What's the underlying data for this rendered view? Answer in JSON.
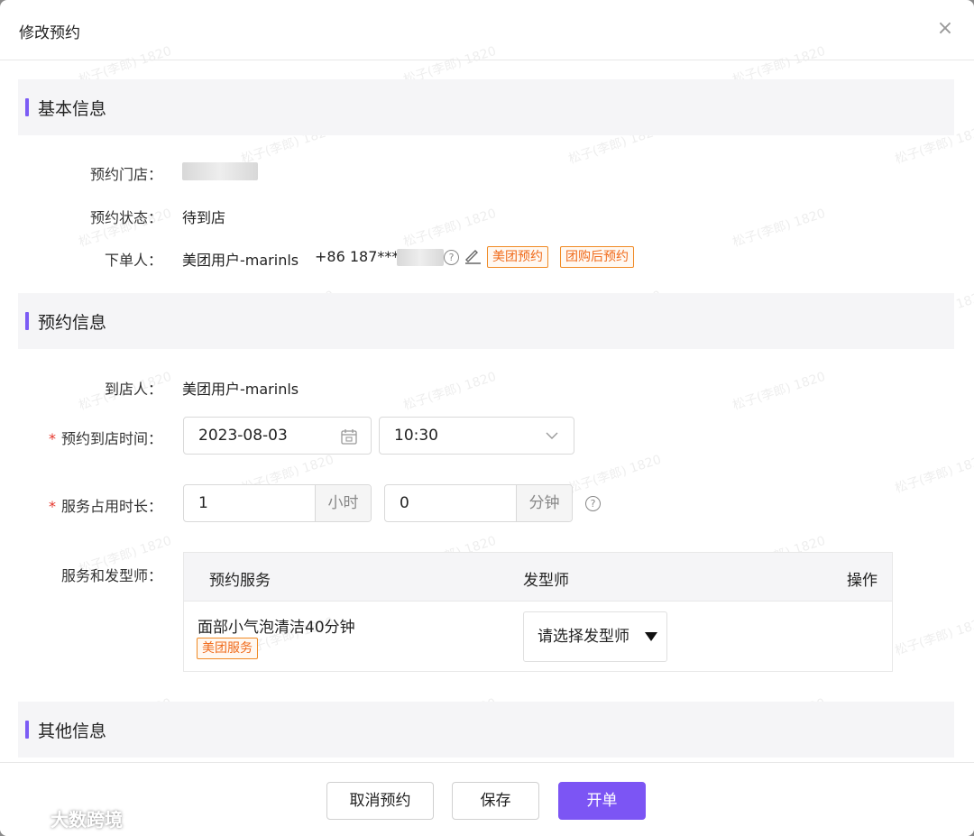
{
  "modal": {
    "title": "修改预约"
  },
  "sections": {
    "basic": "基本信息",
    "booking": "预约信息",
    "other": "其他信息"
  },
  "basic": {
    "store_label": "预约门店：",
    "status_label": "预约状态：",
    "status_value": "待到店",
    "orderer_label": "下单人：",
    "orderer_name": "美团用户-marinls",
    "orderer_phone": "+86 187***",
    "tags": [
      "美团预约",
      "团购后预约"
    ]
  },
  "booking": {
    "visitor_label": "到店人：",
    "visitor_value": "美团用户-marinls",
    "time_label": "预约到店时间：",
    "date_value": "2023-08-03",
    "time_value": "10:30",
    "duration_label": "服务占用时长：",
    "hours_value": "1",
    "hours_unit": "小时",
    "minutes_value": "0",
    "minutes_unit": "分钟",
    "services_label": "服务和发型师：",
    "table": {
      "headers": [
        "预约服务",
        "发型师",
        "操作"
      ],
      "row": {
        "service": "面部小气泡清洁40分钟",
        "tag": "美团服务",
        "stylist_placeholder": "请选择发型师"
      }
    }
  },
  "footer": {
    "cancel_label": "取消预约",
    "save_label": "保存",
    "open_label": "开单"
  },
  "watermark": "松子(李郎) 1820",
  "brand": "大数跨境",
  "colors": {
    "accent": "#7c55f4",
    "tag_orange": "#f06b1c",
    "required": "#e5352b"
  }
}
